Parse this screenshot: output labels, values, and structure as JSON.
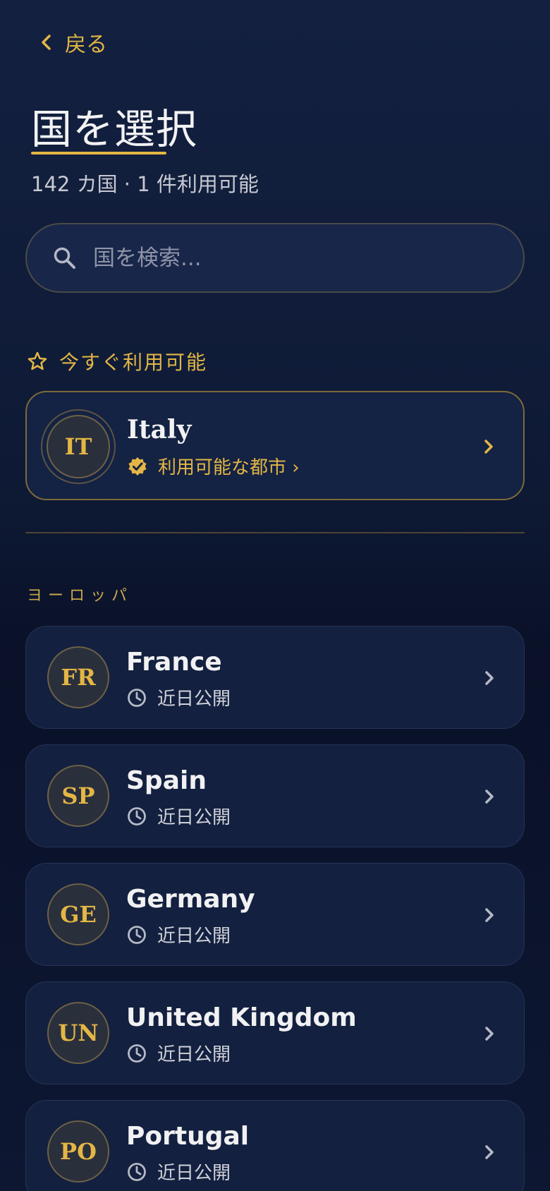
{
  "nav": {
    "back_label": "戻る"
  },
  "header": {
    "title": "国を選択",
    "subtitle": "142 カ国 · 1 件利用可能"
  },
  "search": {
    "placeholder": "国を検索..."
  },
  "featured_section": {
    "label": "今すぐ利用可能",
    "country": {
      "code": "IT",
      "name": "Italy",
      "status": "利用可能な都市 ›"
    }
  },
  "region": {
    "label": "ヨーロッパ",
    "countries": [
      {
        "code": "FR",
        "name": "France",
        "status": "近日公開"
      },
      {
        "code": "SP",
        "name": "Spain",
        "status": "近日公開"
      },
      {
        "code": "GE",
        "name": "Germany",
        "status": "近日公開"
      },
      {
        "code": "UN",
        "name": "United Kingdom",
        "status": "近日公開"
      },
      {
        "code": "PO",
        "name": "Portugal",
        "status": "近日公開"
      }
    ]
  },
  "colors": {
    "accent": "#e3b645",
    "background": "#0e1a35",
    "card": "#13203f"
  },
  "icons": {
    "back": "chevron-left-icon",
    "search": "search-icon",
    "featured": "star-icon",
    "available": "verified-badge-icon",
    "coming_soon": "clock-icon",
    "row": "chevron-right-icon"
  }
}
